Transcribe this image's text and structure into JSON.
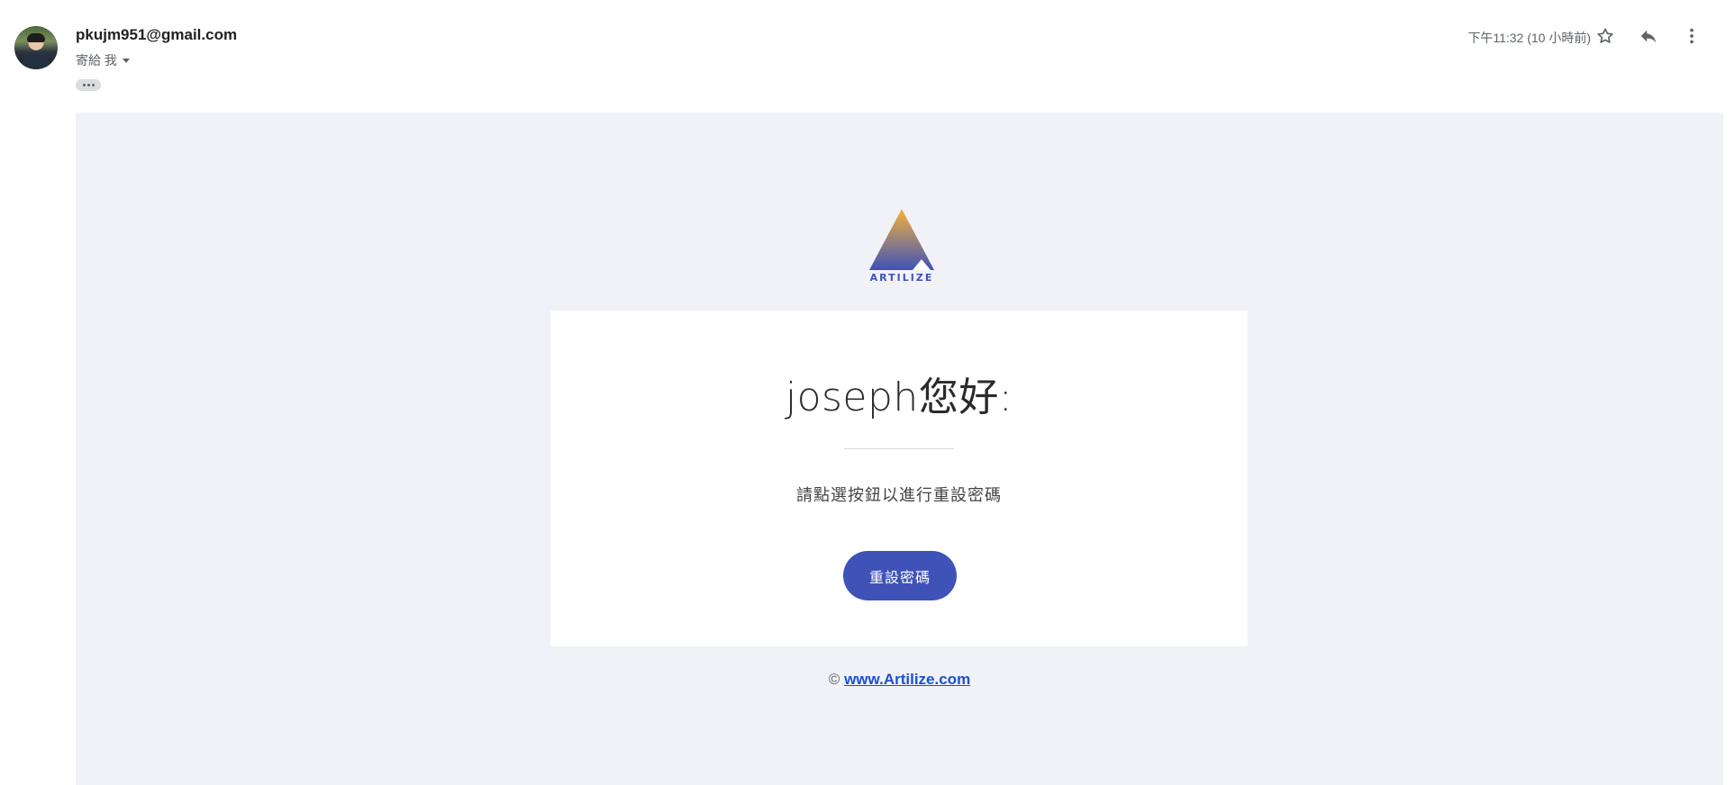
{
  "header": {
    "sender_email": "pkujm951@gmail.com",
    "to_line": "寄給 我",
    "timestamp": "下午11:32 (10 小時前)",
    "icons": [
      "star-icon",
      "reply-icon",
      "more-vert-icon"
    ]
  },
  "email": {
    "brand": "ARTILIZE",
    "greeting": "joseph您好:",
    "instruction": "請點選按鈕以進行重設密碼",
    "button_label": "重設密碼",
    "footer_copyright": "©",
    "footer_link": "www.Artilize.com"
  },
  "colors": {
    "button": "#3f52b8",
    "canvas_bg": "#f1f2f7",
    "link": "#1a4fd6",
    "logo_top": "#f5b33c",
    "logo_bottom": "#3f52b8"
  }
}
